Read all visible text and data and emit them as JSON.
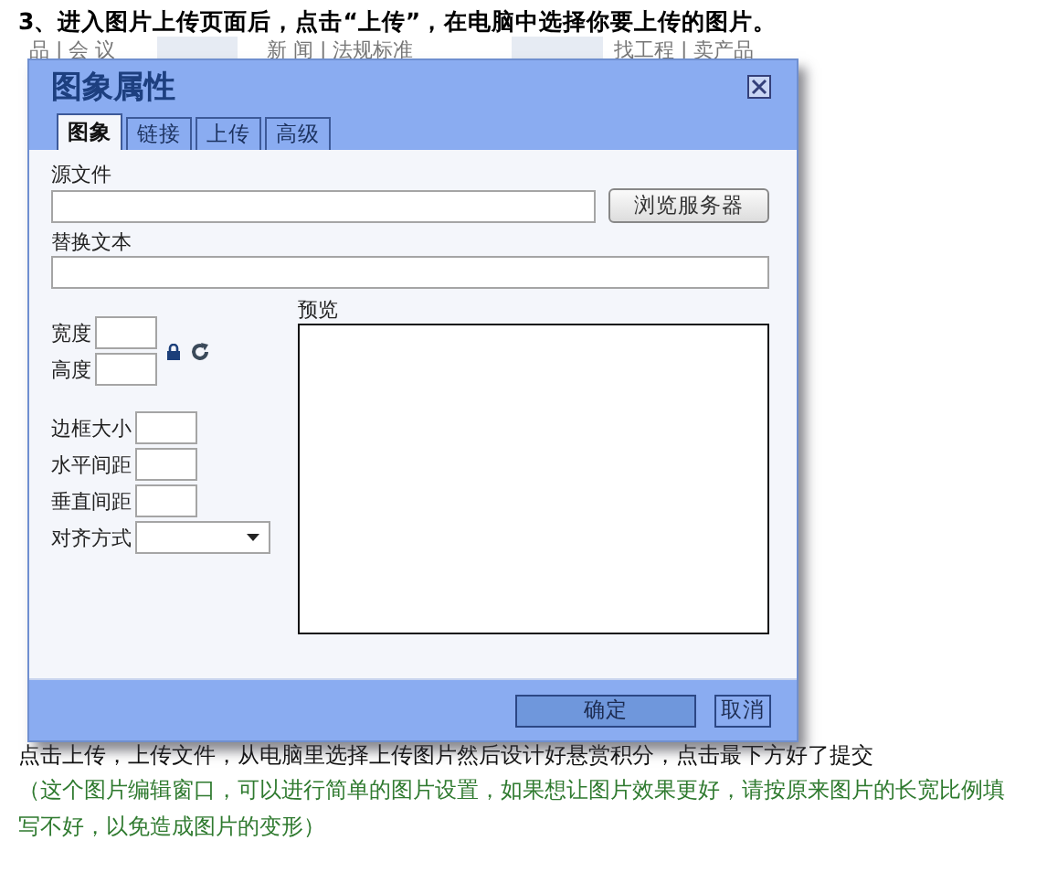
{
  "heading": "3、进入图片上传页面后，点击“上传”，在电脑中选择你要上传的图片。",
  "background_nav": [
    "品 | 会 议",
    "新 闻 | 法规标准",
    "找工程 | 卖产品"
  ],
  "dialog": {
    "title": "图象属性",
    "tabs": [
      {
        "label": "图象",
        "selected": true
      },
      {
        "label": "链接",
        "selected": false
      },
      {
        "label": "上传",
        "selected": false
      },
      {
        "label": "高级",
        "selected": false
      }
    ],
    "source_label": "源文件",
    "browse_button": "浏览服务器",
    "alt_label": "替换文本",
    "width_label": "宽度",
    "height_label": "高度",
    "spacing_fields": [
      {
        "label": "边框大小"
      },
      {
        "label": "水平间距"
      },
      {
        "label": "垂直间距"
      }
    ],
    "align_label": "对齐方式",
    "preview_label": "预览",
    "ok_button": "确定",
    "cancel_button": "取消"
  },
  "instruction": "点击上传，上传文件，从电脑里选择上传图片然后设计好悬赏积分，点击最下方好了提交",
  "note": "（这个图片编辑窗口，可以进行简单的图片设置，如果想让图片效果更好，请按原来图片的长宽比例填写不好，以免造成图片的变形）"
}
